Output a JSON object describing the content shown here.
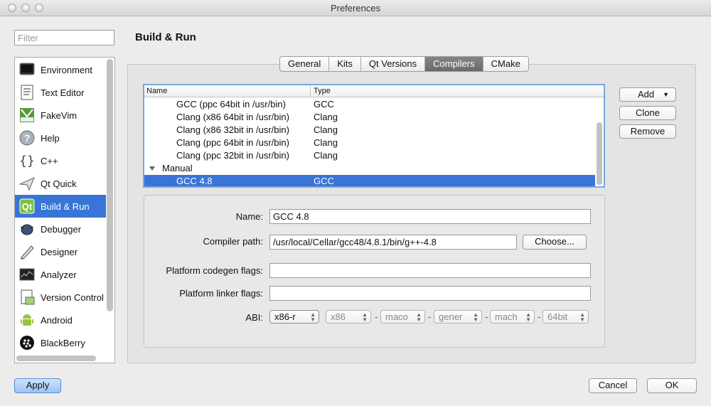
{
  "window": {
    "title": "Preferences"
  },
  "filter": {
    "placeholder": "Filter"
  },
  "sidebar": {
    "items": [
      {
        "label": "Environment",
        "icon": "monitor-icon"
      },
      {
        "label": "Text Editor",
        "icon": "text-document-icon"
      },
      {
        "label": "FakeVim",
        "icon": "fakevim-icon"
      },
      {
        "label": "Help",
        "icon": "help-icon"
      },
      {
        "label": "C++",
        "icon": "cpp-braces-icon"
      },
      {
        "label": "Qt Quick",
        "icon": "paper-plane-icon"
      },
      {
        "label": "Build & Run",
        "icon": "qt-build-icon",
        "selected": true
      },
      {
        "label": "Debugger",
        "icon": "bug-icon"
      },
      {
        "label": "Designer",
        "icon": "designer-icon"
      },
      {
        "label": "Analyzer",
        "icon": "analyzer-icon"
      },
      {
        "label": "Version Control",
        "icon": "version-control-icon"
      },
      {
        "label": "Android",
        "icon": "android-icon"
      },
      {
        "label": "BlackBerry",
        "icon": "blackberry-icon"
      }
    ]
  },
  "page": {
    "title": "Build & Run"
  },
  "tabs": [
    {
      "label": "General"
    },
    {
      "label": "Kits"
    },
    {
      "label": "Qt Versions"
    },
    {
      "label": "Compilers",
      "active": true
    },
    {
      "label": "CMake"
    }
  ],
  "compilers": {
    "columns": [
      "Name",
      "Type"
    ],
    "rows": [
      {
        "name": "GCC (ppc 64bit in /usr/bin)",
        "type": "GCC"
      },
      {
        "name": "Clang (x86 64bit in /usr/bin)",
        "type": "Clang"
      },
      {
        "name": "Clang (x86 32bit in /usr/bin)",
        "type": "Clang"
      },
      {
        "name": "Clang (ppc 64bit in /usr/bin)",
        "type": "Clang"
      },
      {
        "name": "Clang (ppc 32bit in /usr/bin)",
        "type": "Clang"
      }
    ],
    "manual_group": "Manual",
    "manual_rows": [
      {
        "name": "GCC 4.8",
        "type": "GCC",
        "selected": true
      }
    ]
  },
  "actions": {
    "add": "Add",
    "clone": "Clone",
    "remove": "Remove"
  },
  "details": {
    "name_label": "Name:",
    "name_value": "GCC 4.8",
    "path_label": "Compiler path:",
    "path_value": "/usr/local/Cellar/gcc48/4.8.1/bin/g++-4.8",
    "choose": "Choose...",
    "codegen_label": "Platform codegen flags:",
    "codegen_value": "",
    "linker_label": "Platform linker flags:",
    "linker_value": "",
    "abi_label": "ABI:",
    "abi": {
      "preset": "x86-r",
      "arch": "x86",
      "os": "maco",
      "flavor": "gener",
      "format": "mach",
      "width": "64bit"
    }
  },
  "footer": {
    "apply": "Apply",
    "cancel": "Cancel",
    "ok": "OK"
  }
}
